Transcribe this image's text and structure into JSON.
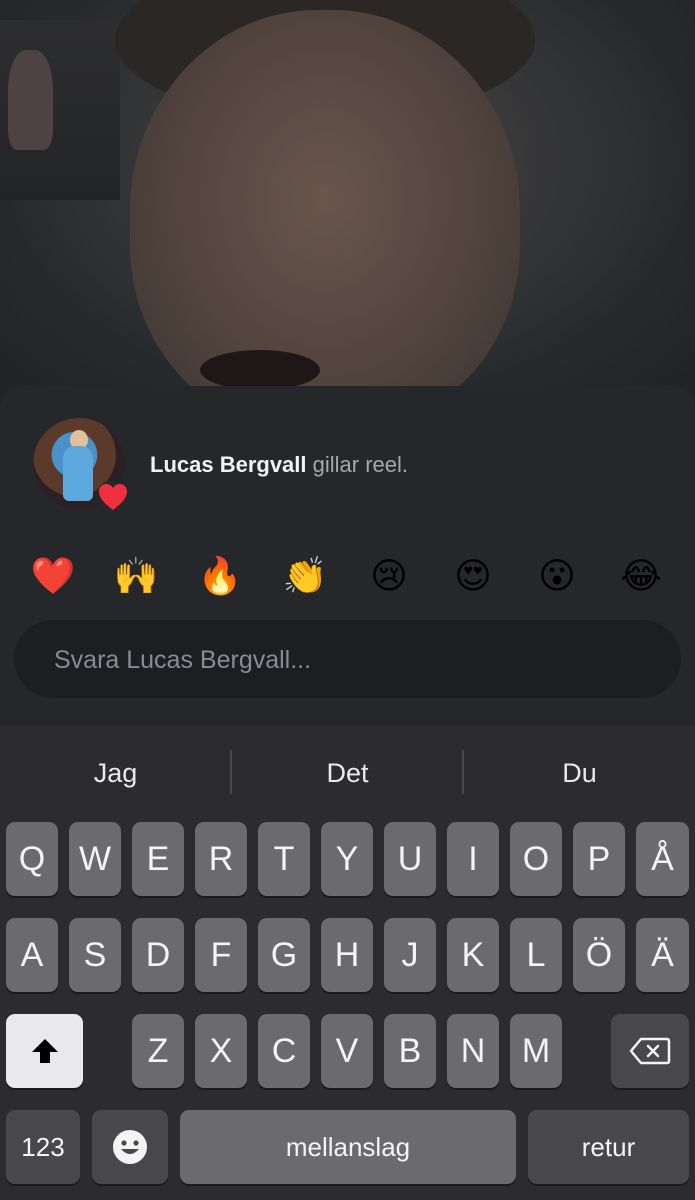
{
  "sheet": {
    "liker_name": "Lucas Bergvall",
    "like_action": "gillar reel.",
    "reactions": [
      "❤️",
      "🙌",
      "🔥",
      "👏",
      "😢",
      "😍",
      "😮",
      "😂"
    ],
    "reply_placeholder": "Svara Lucas Bergvall..."
  },
  "keyboard": {
    "suggestions": [
      "Jag",
      "Det",
      "Du"
    ],
    "row1": [
      "Q",
      "W",
      "E",
      "R",
      "T",
      "Y",
      "U",
      "I",
      "O",
      "P",
      "Å"
    ],
    "row2": [
      "A",
      "S",
      "D",
      "F",
      "G",
      "H",
      "J",
      "K",
      "L",
      "Ö",
      "Ä"
    ],
    "row3": [
      "Z",
      "X",
      "C",
      "V",
      "B",
      "N",
      "M"
    ],
    "numbers_label": "123",
    "space_label": "mellanslag",
    "return_label": "retur"
  }
}
